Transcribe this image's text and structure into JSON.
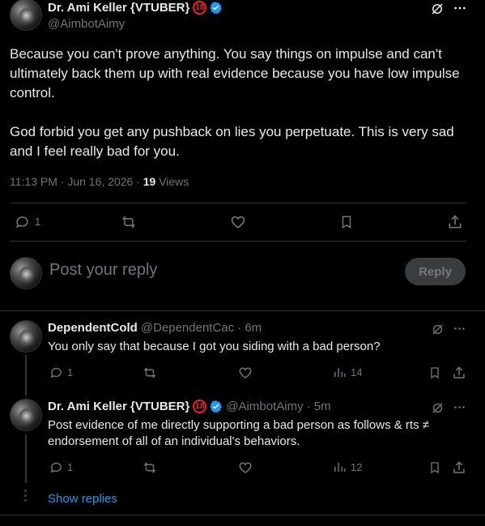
{
  "main_tweet": {
    "author_name": "Dr. Ami Keller {VTUBER}",
    "badge_18": "18",
    "handle": "@AimbotAimy",
    "paragraph1": "Because you can't prove anything. You say things on impulse and can't ultimately back them up with real evidence because you have low impulse control.",
    "paragraph2": "God forbid you get any pushback on lies you perpetuate. This is very sad and I feel really bad for you.",
    "timestamp": "11:13 PM · Jun 16, 2026 · ",
    "views_count": "19",
    "views_label": " Views",
    "reply_count": "1"
  },
  "composer": {
    "placeholder": "Post your reply",
    "reply_button": "Reply"
  },
  "replies": [
    {
      "author_name": "DependentCold",
      "handle": "@DependentCac",
      "time": "· 6m",
      "text": "You only say that because I got you siding with a bad person?",
      "reply_count": "1",
      "views": "14"
    },
    {
      "author_name": "Dr. Ami Keller {VTUBER}",
      "badge_18": "18",
      "handle": "@AimbotAimy",
      "time": "· 5m",
      "text": "Post evidence of me directly supporting a bad person as follows & rts ≠ endorsement of all of an individual's behaviors.",
      "reply_count": "1",
      "views": "12"
    }
  ],
  "show_replies": "Show replies",
  "colors": {
    "background": "#000000",
    "text": "#e7e9ea",
    "muted": "#71767b",
    "accent": "#1d9bf0",
    "divider": "#2f3336"
  }
}
